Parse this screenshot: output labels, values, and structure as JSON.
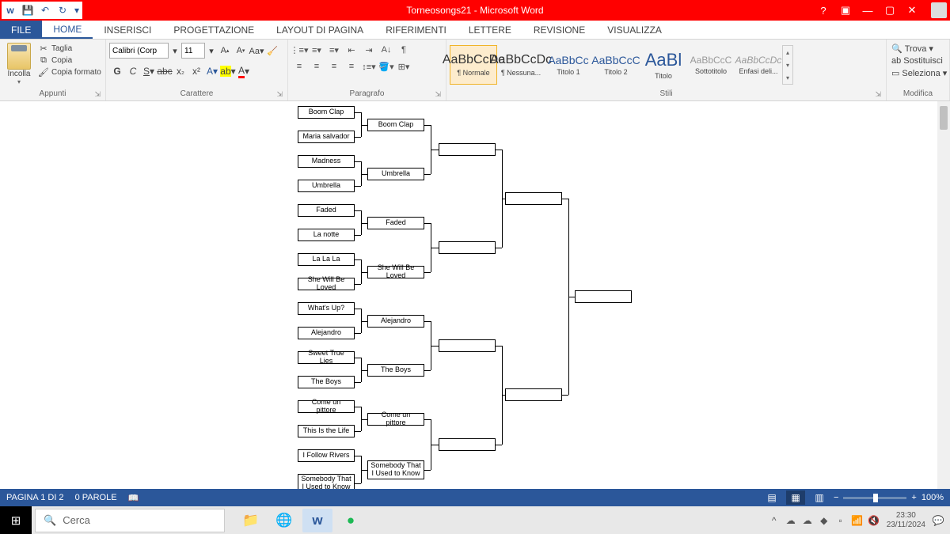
{
  "title": "Torneosongs21 - Microsoft Word",
  "tabs": {
    "file": "FILE",
    "home": "HOME",
    "insert": "INSERISCI",
    "design": "PROGETTAZIONE",
    "layout": "LAYOUT DI PAGINA",
    "references": "RIFERIMENTI",
    "mailings": "LETTERE",
    "review": "REVISIONE",
    "view": "VISUALIZZA"
  },
  "ribbon": {
    "clipboard": {
      "label": "Appunti",
      "paste": "Incolla",
      "cut": "Taglia",
      "copy": "Copia",
      "formatPainter": "Copia formato"
    },
    "font": {
      "label": "Carattere",
      "name": "Calibri (Corp",
      "size": "11"
    },
    "paragraph": {
      "label": "Paragrafo"
    },
    "styles": {
      "label": "Stili",
      "items": [
        {
          "preview": "AaBbCcDc",
          "name": "¶ Normale"
        },
        {
          "preview": "AaBbCcDc",
          "name": "¶ Nessuna..."
        },
        {
          "preview": "AaBbCc",
          "name": "Titolo 1"
        },
        {
          "preview": "AaBbCcC",
          "name": "Titolo 2"
        },
        {
          "preview": "AaBl",
          "name": "Titolo"
        },
        {
          "preview": "AaBbCcC",
          "name": "Sottotitolo"
        },
        {
          "preview": "AaBbCcDc",
          "name": "Enfasi deli..."
        }
      ]
    },
    "editing": {
      "label": "Modifica",
      "find": "Trova",
      "replace": "Sostituisci",
      "select": "Seleziona"
    }
  },
  "bracket": {
    "r1": [
      "Boom Clap",
      "Maria salvador",
      "Madness",
      "Umbrella",
      "Faded",
      "La notte",
      "La La La",
      "She Will Be Loved",
      "What's Up?",
      "Alejandro",
      "Sweet True Lies",
      "The Boys",
      "Come un pittore",
      "This Is the Life",
      "I Follow Rivers",
      "Somebody That I Used to Know"
    ],
    "r2": [
      "Boom Clap",
      "Umbrella",
      "Faded",
      "She Will Be Loved",
      "Alejandro",
      "The Boys",
      "Come un pittore",
      "Somebody That I Used to Know"
    ]
  },
  "status": {
    "page": "PAGINA 1 DI 2",
    "words": "0 PAROLE",
    "zoom": "100%"
  },
  "taskbar": {
    "search": "Cerca",
    "time": "23:30",
    "date": "23/11/2024"
  }
}
